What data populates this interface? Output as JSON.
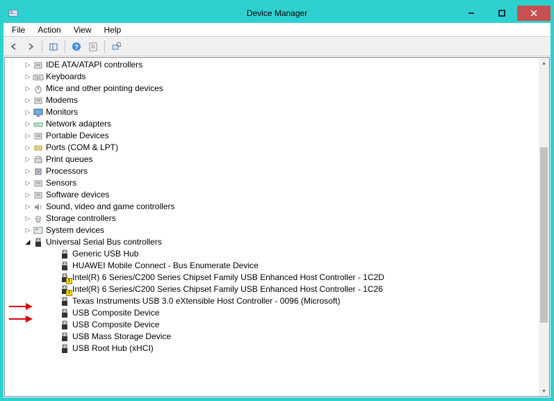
{
  "window": {
    "title": "Device Manager"
  },
  "menu": {
    "file": "File",
    "action": "Action",
    "view": "View",
    "help": "Help"
  },
  "tree": {
    "categories": [
      {
        "label": "IDE ATA/ATAPI controllers",
        "icon": "controller"
      },
      {
        "label": "Keyboards",
        "icon": "keyboard"
      },
      {
        "label": "Mice and other pointing devices",
        "icon": "mouse"
      },
      {
        "label": "Modems",
        "icon": "modem"
      },
      {
        "label": "Monitors",
        "icon": "monitor"
      },
      {
        "label": "Network adapters",
        "icon": "network"
      },
      {
        "label": "Portable Devices",
        "icon": "portable"
      },
      {
        "label": "Ports (COM & LPT)",
        "icon": "port"
      },
      {
        "label": "Print queues",
        "icon": "printer"
      },
      {
        "label": "Processors",
        "icon": "cpu"
      },
      {
        "label": "Sensors",
        "icon": "sensor"
      },
      {
        "label": "Software devices",
        "icon": "software"
      },
      {
        "label": "Sound, video and game controllers",
        "icon": "sound"
      },
      {
        "label": "Storage controllers",
        "icon": "storage"
      },
      {
        "label": "System devices",
        "icon": "system"
      }
    ],
    "usb_category": {
      "label": "Universal Serial Bus controllers",
      "items": [
        {
          "label": "Generic USB Hub",
          "warn": false
        },
        {
          "label": "HUAWEI Mobile Connect - Bus Enumerate Device",
          "warn": false
        },
        {
          "label": "Intel(R) 6 Series/C200 Series Chipset Family USB Enhanced Host Controller - 1C2D",
          "warn": true
        },
        {
          "label": "Intel(R) 6 Series/C200 Series Chipset Family USB Enhanced Host Controller - 1C26",
          "warn": true
        },
        {
          "label": "Texas Instruments USB 3.0 eXtensible Host Controller - 0096 (Microsoft)",
          "warn": false
        },
        {
          "label": "USB Composite Device",
          "warn": false
        },
        {
          "label": "USB Composite Device",
          "warn": false
        },
        {
          "label": "USB Mass Storage Device",
          "warn": false
        },
        {
          "label": "USB Root Hub (xHCI)",
          "warn": false
        }
      ]
    }
  }
}
